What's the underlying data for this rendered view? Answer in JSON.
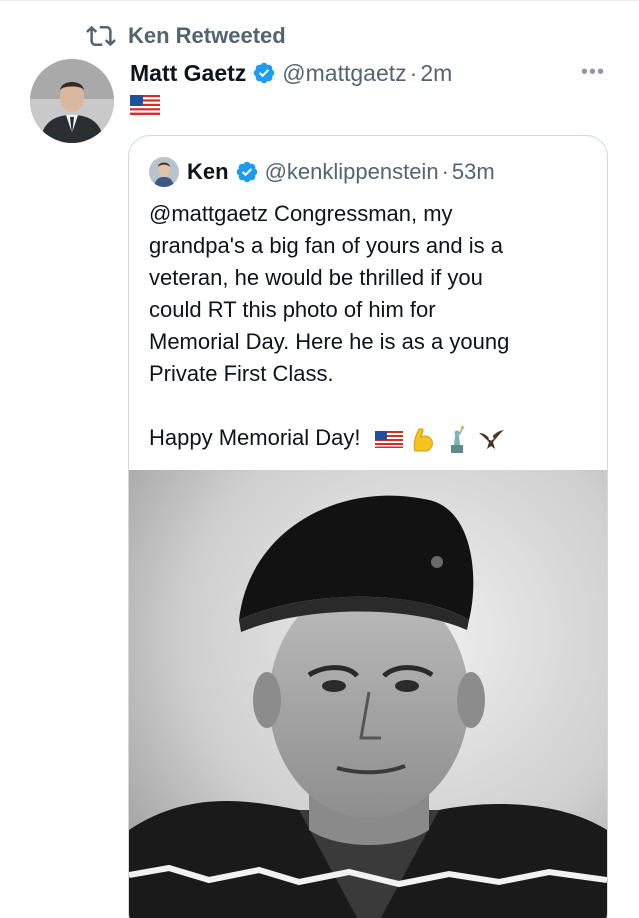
{
  "retweet_context": {
    "icon": "retweet-icon",
    "label": "Ken Retweeted"
  },
  "tweet": {
    "author_name": "Matt Gaetz",
    "author_handle": "@mattgaetz",
    "separator": "·",
    "time": "2m",
    "verified": true,
    "more_label": "•••",
    "body_emoji": "us-flag-emoji"
  },
  "quoted_tweet": {
    "author_name": "Ken",
    "author_handle": "@kenklippenstein",
    "separator": "·",
    "time": "53m",
    "verified": true,
    "text_lines": [
      "@mattgaetz Congressman, my",
      "grandpa's a big fan of yours and is a",
      "veteran, he would be thrilled if you",
      "could RT this photo of him for",
      "Memorial Day. Here he is as a young",
      "Private First Class."
    ],
    "closing_text": "Happy Memorial Day!",
    "closing_emojis": [
      "us-flag-emoji",
      "flexed-biceps-emoji",
      "statue-of-liberty-emoji",
      "eagle-emoji"
    ],
    "photo": "black-and-white-portrait-of-young-soldier"
  },
  "colors": {
    "verified_blue": "#1d9bf0",
    "secondary_text": "#536471",
    "border": "#cfd9de"
  }
}
